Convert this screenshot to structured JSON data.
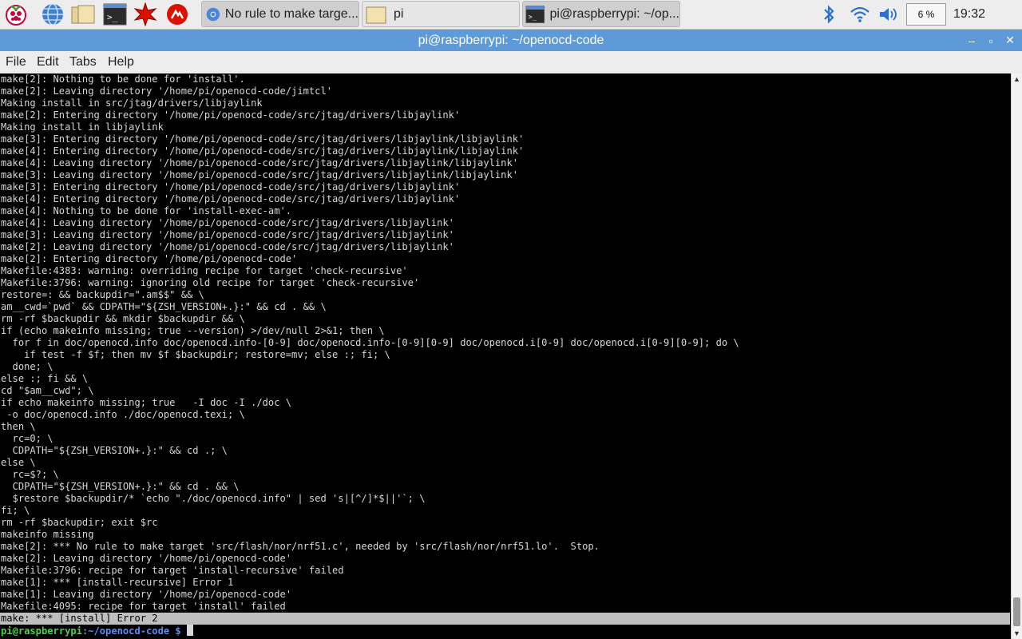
{
  "taskbar": {
    "tasks": [
      {
        "label": "No rule to make targe..."
      },
      {
        "label": "pi"
      },
      {
        "label": "pi@raspberrypi: ~/op..."
      }
    ],
    "cpu": "6 %",
    "clock": "19:32"
  },
  "window": {
    "title": "pi@raspberrypi: ~/openocd-code",
    "minimize": "–",
    "maximize": "▫",
    "close": "✕"
  },
  "menu": [
    "File",
    "Edit",
    "Tabs",
    "Help"
  ],
  "terminal": {
    "lines": [
      "make[2]: Nothing to be done for 'install'.",
      "make[2]: Leaving directory '/home/pi/openocd-code/jimtcl'",
      "Making install in src/jtag/drivers/libjaylink",
      "make[2]: Entering directory '/home/pi/openocd-code/src/jtag/drivers/libjaylink'",
      "Making install in libjaylink",
      "make[3]: Entering directory '/home/pi/openocd-code/src/jtag/drivers/libjaylink/libjaylink'",
      "make[4]: Entering directory '/home/pi/openocd-code/src/jtag/drivers/libjaylink/libjaylink'",
      "make[4]: Leaving directory '/home/pi/openocd-code/src/jtag/drivers/libjaylink/libjaylink'",
      "make[3]: Leaving directory '/home/pi/openocd-code/src/jtag/drivers/libjaylink/libjaylink'",
      "make[3]: Entering directory '/home/pi/openocd-code/src/jtag/drivers/libjaylink'",
      "make[4]: Entering directory '/home/pi/openocd-code/src/jtag/drivers/libjaylink'",
      "make[4]: Nothing to be done for 'install-exec-am'.",
      "make[4]: Leaving directory '/home/pi/openocd-code/src/jtag/drivers/libjaylink'",
      "make[3]: Leaving directory '/home/pi/openocd-code/src/jtag/drivers/libjaylink'",
      "make[2]: Leaving directory '/home/pi/openocd-code/src/jtag/drivers/libjaylink'",
      "make[2]: Entering directory '/home/pi/openocd-code'",
      "Makefile:4383: warning: overriding recipe for target 'check-recursive'",
      "Makefile:3796: warning: ignoring old recipe for target 'check-recursive'",
      "restore=: && backupdir=\".am$$\" && \\",
      "am__cwd=`pwd` && CDPATH=\"${ZSH_VERSION+.}:\" && cd . && \\",
      "rm -rf $backupdir && mkdir $backupdir && \\",
      "if (echo makeinfo missing; true --version) >/dev/null 2>&1; then \\",
      "  for f in doc/openocd.info doc/openocd.info-[0-9] doc/openocd.info-[0-9][0-9] doc/openocd.i[0-9] doc/openocd.i[0-9][0-9]; do \\",
      "    if test -f $f; then mv $f $backupdir; restore=mv; else :; fi; \\",
      "  done; \\",
      "else :; fi && \\",
      "cd \"$am__cwd\"; \\",
      "if echo makeinfo missing; true   -I doc -I ./doc \\",
      " -o doc/openocd.info ./doc/openocd.texi; \\",
      "then \\",
      "  rc=0; \\",
      "  CDPATH=\"${ZSH_VERSION+.}:\" && cd .; \\",
      "else \\",
      "  rc=$?; \\",
      "  CDPATH=\"${ZSH_VERSION+.}:\" && cd . && \\",
      "  $restore $backupdir/* `echo \"./doc/openocd.info\" | sed 's|[^/]*$||'`; \\",
      "fi; \\",
      "rm -rf $backupdir; exit $rc",
      "makeinfo missing",
      "make[2]: *** No rule to make target 'src/flash/nor/nrf51.c', needed by 'src/flash/nor/nrf51.lo'.  Stop.",
      "make[2]: Leaving directory '/home/pi/openocd-code'",
      "Makefile:3796: recipe for target 'install-recursive' failed",
      "make[1]: *** [install-recursive] Error 1",
      "make[1]: Leaving directory '/home/pi/openocd-code'",
      "Makefile:4095: recipe for target 'install' failed",
      "make: *** [install] Error 2"
    ],
    "highlighted_index": 45,
    "prompt": {
      "user": "pi@raspberrypi",
      "path": ":~/openocd-code $ "
    }
  },
  "colors": {
    "titlebar": "#5e9ad8",
    "prompt_user": "#4fd04f",
    "prompt_path": "#5c8ef0"
  }
}
